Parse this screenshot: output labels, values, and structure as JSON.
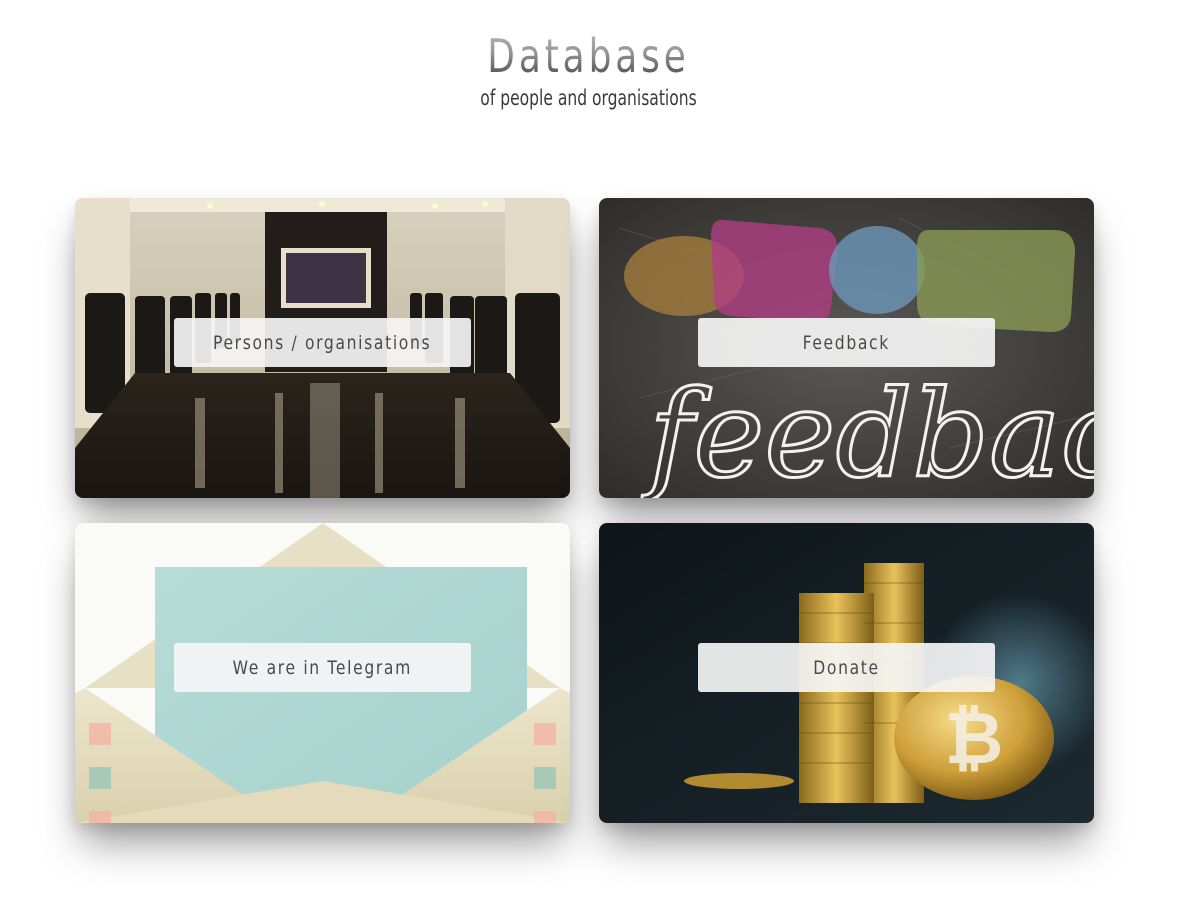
{
  "header": {
    "title": "Database",
    "subtitle": "of people and organisations"
  },
  "cards": [
    {
      "label": "Persons / organisations",
      "image": "conference-room"
    },
    {
      "label": "Feedback",
      "image": "chalkboard-feedback"
    },
    {
      "label": "We are in Telegram",
      "image": "envelope-letter"
    },
    {
      "label": "Donate",
      "image": "bitcoin-coins"
    }
  ],
  "images": {
    "chalkboard_text": "feedback"
  },
  "colors": {
    "title_gradient_top": "#b9b9b9",
    "title_gradient_bottom": "#3c3c3c",
    "subtitle": "#3a3a3a",
    "button_bg": "#f5f5f5",
    "button_text": "#4a4a4a"
  }
}
